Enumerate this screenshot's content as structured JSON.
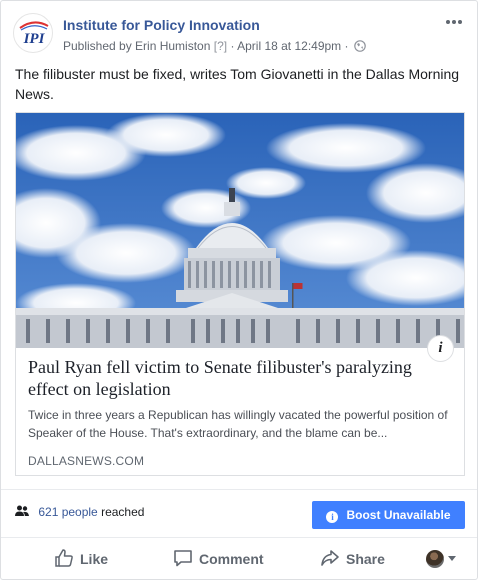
{
  "post": {
    "page_name": "Institute for Policy Innovation",
    "avatar_text": "IPI",
    "published_by": "Published by Erin Humiston",
    "help_marker": "[?]",
    "separator": "·",
    "timestamp": "April 18 at 12:49pm",
    "text": "The filibuster must be fixed, writes Tom Giovanetti in the Dallas Morning News."
  },
  "link": {
    "headline": "Paul Ryan fell victim to Senate filibuster's paralyzing effect on legislation",
    "summary": "Twice in three years a Republican has willingly vacated the powerful position of Speaker of the House. That's extraordinary, and the blame can be...",
    "domain": "DALLASNEWS.COM",
    "info_label": "i"
  },
  "reach": {
    "count_text": "621 people",
    "suffix": "reached"
  },
  "boost": {
    "label": "Boost Unavailable"
  },
  "actions": {
    "like": "Like",
    "comment": "Comment",
    "share": "Share"
  },
  "colors": {
    "brand_link": "#385898",
    "boost_bg": "#4080ff",
    "secondary_text": "#616770"
  }
}
